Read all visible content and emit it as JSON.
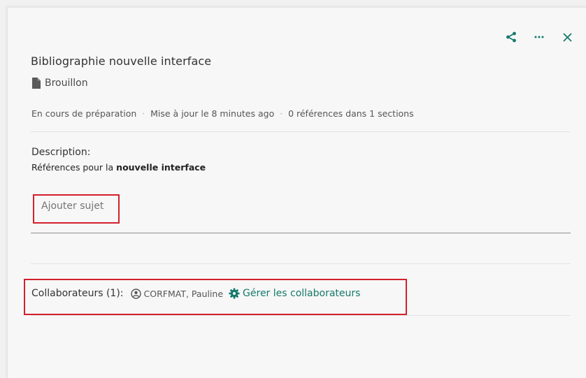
{
  "colors": {
    "accent": "#147a6a",
    "highlight": "#d3202c"
  },
  "actions": {
    "share_icon": "share-icon",
    "more_icon": "more-icon",
    "close_icon": "close-icon"
  },
  "record": {
    "title": "Bibliographie nouvelle interface",
    "status": "Brouillon",
    "status_icon": "document-icon",
    "meta": {
      "state": "En cours de préparation",
      "updated": "Mise à jour le 8 minutes ago",
      "references": "0 références dans 1 sections"
    }
  },
  "description": {
    "label": "Description:",
    "text_prefix": "Références pour la",
    "text_bold": "nouvelle interface"
  },
  "subject": {
    "placeholder": "Ajouter sujet"
  },
  "collaborators": {
    "label": "Collaborateurs (1):",
    "user_icon": "user-circle-icon",
    "user_name": "CORFMAT, Pauline",
    "manage_icon": "gear-icon",
    "manage_label": "Gérer les collaborateurs"
  }
}
